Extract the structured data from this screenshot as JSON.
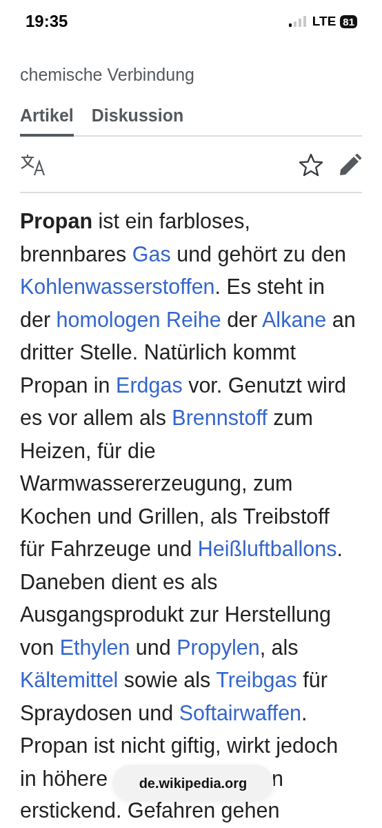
{
  "status_bar": {
    "time": "19:35",
    "network": "LTE",
    "battery": "81"
  },
  "article": {
    "subtitle": "chemische Verbindung"
  },
  "tabs": [
    {
      "label": "Artikel",
      "selected": true
    },
    {
      "label": "Diskussion",
      "selected": false
    }
  ],
  "paragraph_lines": [
    [
      {
        "kind": "bold",
        "text": "Propan"
      },
      {
        "kind": "plain",
        "text": " ist ein farbloses,"
      }
    ],
    [
      {
        "kind": "plain",
        "text": "brennbares "
      },
      {
        "kind": "link",
        "text": "Gas"
      },
      {
        "kind": "plain",
        "text": " und gehört zu den"
      }
    ],
    [
      {
        "kind": "link",
        "text": "Kohlenwasserstoffen"
      },
      {
        "kind": "plain",
        "text": ". Es steht in"
      }
    ],
    [
      {
        "kind": "plain",
        "text": "der "
      },
      {
        "kind": "link",
        "text": "homologen Reihe"
      },
      {
        "kind": "plain",
        "text": " der "
      },
      {
        "kind": "link",
        "text": "Alkane"
      },
      {
        "kind": "plain",
        "text": " an"
      }
    ],
    [
      {
        "kind": "plain",
        "text": "dritter Stelle. Natürlich kommt"
      }
    ],
    [
      {
        "kind": "plain",
        "text": "Propan in "
      },
      {
        "kind": "link",
        "text": "Erdgas"
      },
      {
        "kind": "plain",
        "text": " vor. Genutzt wird"
      }
    ],
    [
      {
        "kind": "plain",
        "text": "es vor allem als "
      },
      {
        "kind": "link",
        "text": "Brennstoff"
      },
      {
        "kind": "plain",
        "text": " zum"
      }
    ],
    [
      {
        "kind": "plain",
        "text": "Heizen, für die"
      }
    ],
    [
      {
        "kind": "plain",
        "text": "Warmwassererzeugung, zum"
      }
    ],
    [
      {
        "kind": "plain",
        "text": "Kochen und Grillen, als Treibstoff"
      }
    ],
    [
      {
        "kind": "plain",
        "text": "für Fahrzeuge und "
      },
      {
        "kind": "link",
        "text": "Heißluftballons"
      },
      {
        "kind": "plain",
        "text": "."
      }
    ],
    [
      {
        "kind": "plain",
        "text": "Daneben dient es als"
      }
    ],
    [
      {
        "kind": "plain",
        "text": "Ausgangsprodukt zur Herstellung"
      }
    ],
    [
      {
        "kind": "plain",
        "text": "von "
      },
      {
        "kind": "link",
        "text": "Ethylen"
      },
      {
        "kind": "plain",
        "text": " und "
      },
      {
        "kind": "link",
        "text": "Propylen"
      },
      {
        "kind": "plain",
        "text": ", als"
      }
    ],
    [
      {
        "kind": "link",
        "text": "Kältemittel"
      },
      {
        "kind": "plain",
        "text": " sowie als "
      },
      {
        "kind": "link",
        "text": "Treibgas"
      },
      {
        "kind": "plain",
        "text": " für"
      }
    ],
    [
      {
        "kind": "plain",
        "text": "Spraydosen und "
      },
      {
        "kind": "link",
        "text": "Softairwaffen"
      },
      {
        "kind": "plain",
        "text": "."
      }
    ],
    [
      {
        "kind": "plain",
        "text": "Propan ist nicht giftig, wirkt jedoch"
      }
    ]
  ],
  "covered_line": {
    "left": "in höhere",
    "right": "n"
  },
  "last_line": "erstickend. Gefahren gehen",
  "url_pill": "de.wikipedia.org"
}
